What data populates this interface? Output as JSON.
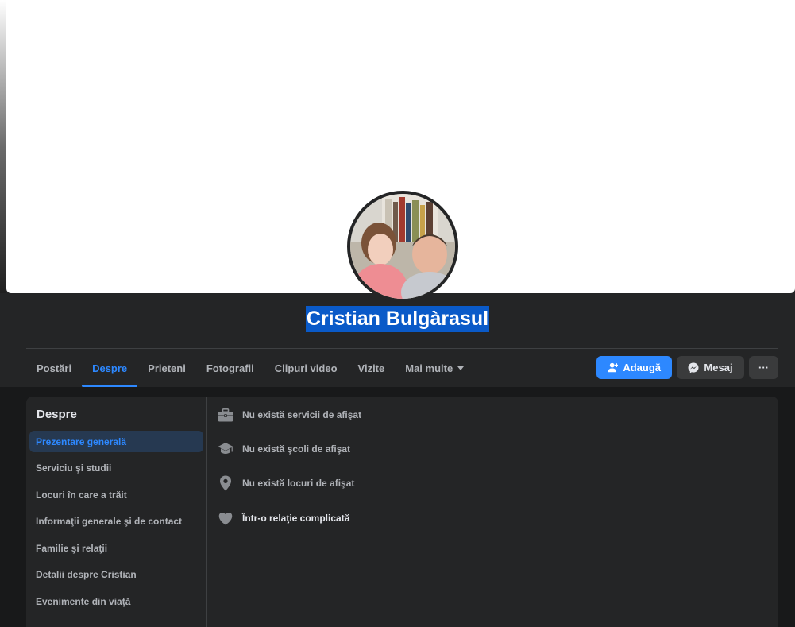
{
  "profile": {
    "name": "Cristian Bulgàrasul"
  },
  "tabs": [
    {
      "label": "Postări"
    },
    {
      "label": "Despre"
    },
    {
      "label": "Prieteni"
    },
    {
      "label": "Fotografii"
    },
    {
      "label": "Clipuri video"
    },
    {
      "label": "Vizite"
    },
    {
      "label": "Mai multe"
    }
  ],
  "actions": {
    "add_label": "Adaugă",
    "message_label": "Mesaj",
    "more_label": "···"
  },
  "about": {
    "title": "Despre",
    "nav": [
      {
        "label": "Prezentare generală"
      },
      {
        "label": "Serviciu şi studii"
      },
      {
        "label": "Locuri în care a trăit"
      },
      {
        "label": "Informaţii generale şi de contact"
      },
      {
        "label": "Familie şi relaţii"
      },
      {
        "label": "Detalii despre Cristian"
      },
      {
        "label": "Evenimente din viaţă"
      }
    ],
    "overview": [
      {
        "icon": "briefcase-icon",
        "text": "Nu există servicii de afişat"
      },
      {
        "icon": "graduation-cap-icon",
        "text": "Nu există şcoli de afişat"
      },
      {
        "icon": "location-pin-icon",
        "text": "Nu există locuri de afişat"
      },
      {
        "icon": "heart-icon",
        "text": "Într-o relaţie complicată"
      }
    ]
  },
  "colors": {
    "accent": "#2d88ff",
    "background": "#18191a",
    "surface": "#242526",
    "name_highlight": "#0a5ac8"
  }
}
